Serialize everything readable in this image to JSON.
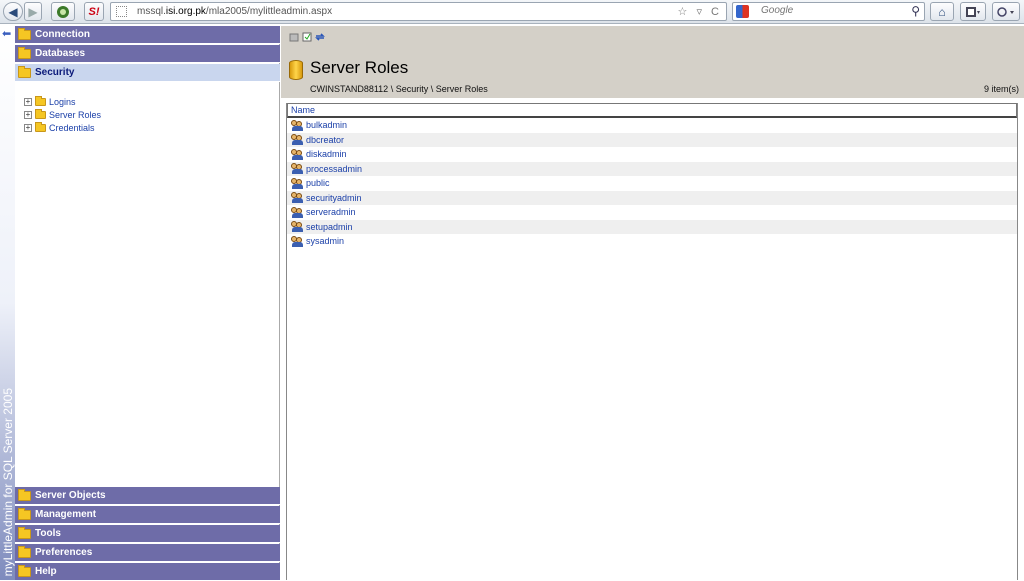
{
  "browser": {
    "url_prefix": "mssql.",
    "url_domain": "isi.org.pk",
    "url_path": "/mla2005/mylittleadmin.aspx",
    "url_icons": "☆ ▿ C",
    "search_placeholder": "Google",
    "back_glyph": "◀",
    "forward_glyph": "▶",
    "s_label": "S!",
    "home_glyph": "⌂",
    "search_glyph": "⚲"
  },
  "brand": {
    "text": "myLittleAdmin for SQL Server 2005",
    "collapse_glyph": "⬅"
  },
  "nav": {
    "top_sections": [
      {
        "label": "Connection"
      },
      {
        "label": "Databases"
      },
      {
        "label": "Security"
      }
    ],
    "tree": [
      {
        "label": "Logins"
      },
      {
        "label": "Server Roles"
      },
      {
        "label": "Credentials"
      }
    ],
    "bottom_sections": [
      {
        "label": "Server Objects"
      },
      {
        "label": "Management"
      },
      {
        "label": "Tools"
      },
      {
        "label": "Preferences"
      },
      {
        "label": "Help"
      }
    ],
    "expand_glyph": "+"
  },
  "main": {
    "title": "Server Roles",
    "breadcrumb": "CWINSTAND88112 \\ Security \\ Server Roles",
    "item_count": "9 item(s)",
    "column_header": "Name",
    "rows": [
      "bulkadmin",
      "dbcreator",
      "diskadmin",
      "processadmin",
      "public",
      "securityadmin",
      "serveradmin",
      "setupadmin",
      "sysadmin"
    ]
  },
  "colors": {
    "nav_header": "#6e6ca8",
    "nav_active": "#c9d6ee",
    "link": "#1a3fa8",
    "main_header_bg": "#d4d0c8"
  }
}
